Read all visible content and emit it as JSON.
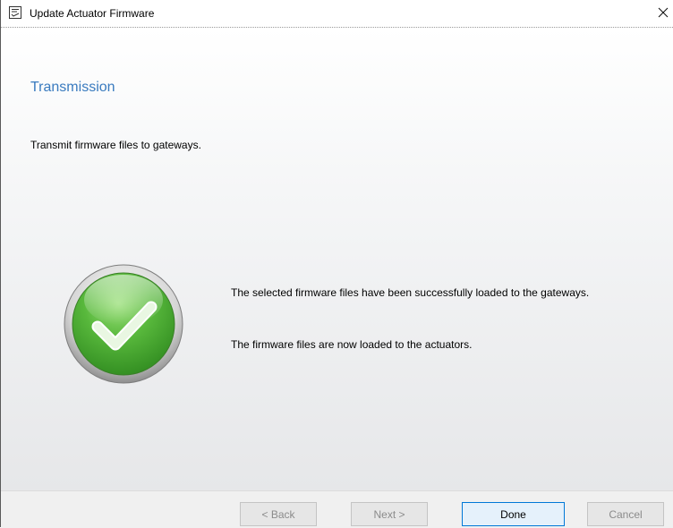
{
  "window": {
    "title": "Update Actuator Firmware",
    "icon": "wizard-list-icon",
    "close_glyph": "✕"
  },
  "page": {
    "heading": "Transmission",
    "description": "Transmit firmware files to gateways.",
    "status_icon": "success-checkmark-icon",
    "message_line1": "The selected firmware files have been successfully loaded to the gateways.",
    "message_line2": "The firmware files are now loaded to the actuators."
  },
  "buttons": {
    "back": "< Back",
    "next": "Next >",
    "done": "Done",
    "cancel": "Cancel"
  },
  "colors": {
    "heading": "#3a7bbf",
    "success_green": "#4fb336",
    "default_button_border": "#0078d7"
  }
}
